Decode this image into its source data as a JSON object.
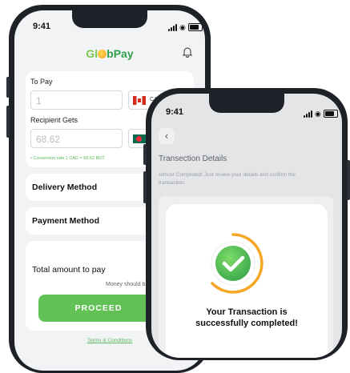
{
  "status_time": "9:41",
  "brand": {
    "part1": "Gl",
    "part2": "bPay"
  },
  "form": {
    "to_pay_label": "To Pay",
    "to_pay_value": "1",
    "from_currency": "CAD",
    "recipient_label": "Recipient Gets",
    "recipient_value": "68.62",
    "conversion_text": "• Conversion rate 1 CAD = 68.62 BDT"
  },
  "delivery_label": "Delivery Method",
  "payment_label": "Payment Method",
  "total_label": "Total amount to pay",
  "money_note": "Money should b",
  "proceed_label": "PROCEED",
  "terms_label": "Terms & Conditions",
  "details": {
    "title": "Transection Details",
    "subtitle": "Almost Completed! Just review your details and confirm the transaction."
  },
  "modal": {
    "line1": "Your Transaction is",
    "line2": "successfully completed!"
  },
  "colors": {
    "accent": "#62c155",
    "ring": "#f5a623"
  }
}
